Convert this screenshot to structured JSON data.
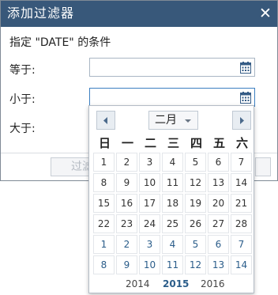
{
  "dialog": {
    "title": "添加过滤器",
    "close_symbol": "✕",
    "subtitle": "指定 \"DATE\" 的条件",
    "fields": [
      {
        "label": "等于:",
        "value": ""
      },
      {
        "label": "小于:",
        "value": ""
      },
      {
        "label": "大于:",
        "value": ""
      }
    ],
    "footer_buttons": [
      "过滤"
    ]
  },
  "datepicker": {
    "month": "二月",
    "weekdays": [
      "日",
      "一",
      "二",
      "三",
      "四",
      "五",
      "六"
    ],
    "weeks": [
      [
        1,
        2,
        3,
        4,
        5,
        6,
        7
      ],
      [
        8,
        9,
        10,
        11,
        12,
        13,
        14
      ],
      [
        15,
        16,
        17,
        18,
        19,
        20,
        21
      ],
      [
        22,
        23,
        24,
        25,
        26,
        27,
        28
      ],
      [
        1,
        2,
        3,
        4,
        5,
        6,
        7
      ],
      [
        8,
        9,
        10,
        11,
        12,
        13,
        14
      ]
    ],
    "other_month_weeks": [
      4,
      5
    ],
    "years": [
      "2014",
      "2015",
      "2016"
    ],
    "selected_year": "2015"
  },
  "colors": {
    "titlebar": "#38587a",
    "accent": "#2b5d8a",
    "field_border": "#a9b6c4"
  },
  "icons": {
    "calendar": "calendar-icon",
    "close": "close-icon",
    "prev": "chevron-left-icon",
    "next": "chevron-right-icon"
  }
}
